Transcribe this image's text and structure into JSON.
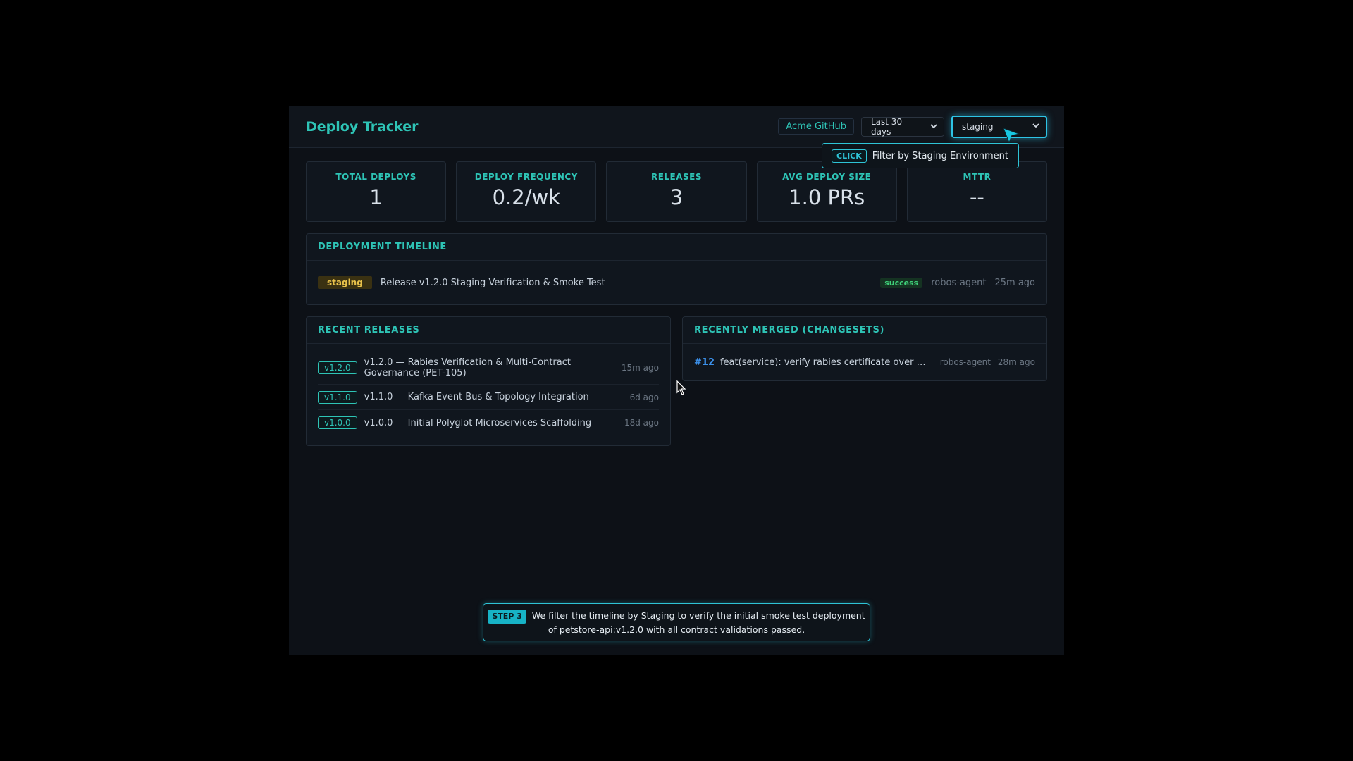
{
  "header": {
    "title": "Deploy Tracker",
    "org": "Acme GitHub",
    "range_select": "Last 30 days",
    "env_select": "staging"
  },
  "tooltip": {
    "action": "CLICK",
    "text": "Filter by Staging Environment"
  },
  "stats": [
    {
      "label": "TOTAL DEPLOYS",
      "value": "1"
    },
    {
      "label": "DEPLOY FREQUENCY",
      "value": "0.2/wk"
    },
    {
      "label": "RELEASES",
      "value": "3"
    },
    {
      "label": "AVG DEPLOY SIZE",
      "value": "1.0 PRs"
    },
    {
      "label": "MTTR",
      "value": "--"
    }
  ],
  "timeline": {
    "title": "DEPLOYMENT TIMELINE",
    "items": [
      {
        "env": "staging",
        "title": "Release v1.2.0 Staging Verification & Smoke Test",
        "status": "success",
        "author": "robos-agent",
        "time": "25m ago"
      }
    ]
  },
  "releases": {
    "title": "RECENT RELEASES",
    "items": [
      {
        "version": "v1.2.0",
        "title": "v1.2.0 — Rabies Verification & Multi-Contract Governance (PET-105)",
        "time": "15m ago"
      },
      {
        "version": "v1.1.0",
        "title": "v1.1.0 — Kafka Event Bus & Topology Integration",
        "time": "6d ago"
      },
      {
        "version": "v1.0.0",
        "title": "v1.0.0 — Initial Polyglot Microservices Scaffolding",
        "time": "18d ago"
      }
    ]
  },
  "merged": {
    "title": "RECENTLY MERGED (CHANGESETS)",
    "items": [
      {
        "number": "#12",
        "title": "feat(service): verify rabies certificate over m...",
        "author": "robos-agent",
        "time": "28m ago"
      }
    ]
  },
  "step": {
    "label": "STEP 3",
    "text": "We filter the timeline by Staging to verify the initial smoke test deployment of petstore-api:v1.2.0 with all contract validations passed."
  },
  "colors": {
    "accent": "#2ec4b6",
    "highlight": "#2ec4e6",
    "staging": "#e8c14a",
    "success": "#3fd27a",
    "pr_link": "#3b8fe8"
  }
}
